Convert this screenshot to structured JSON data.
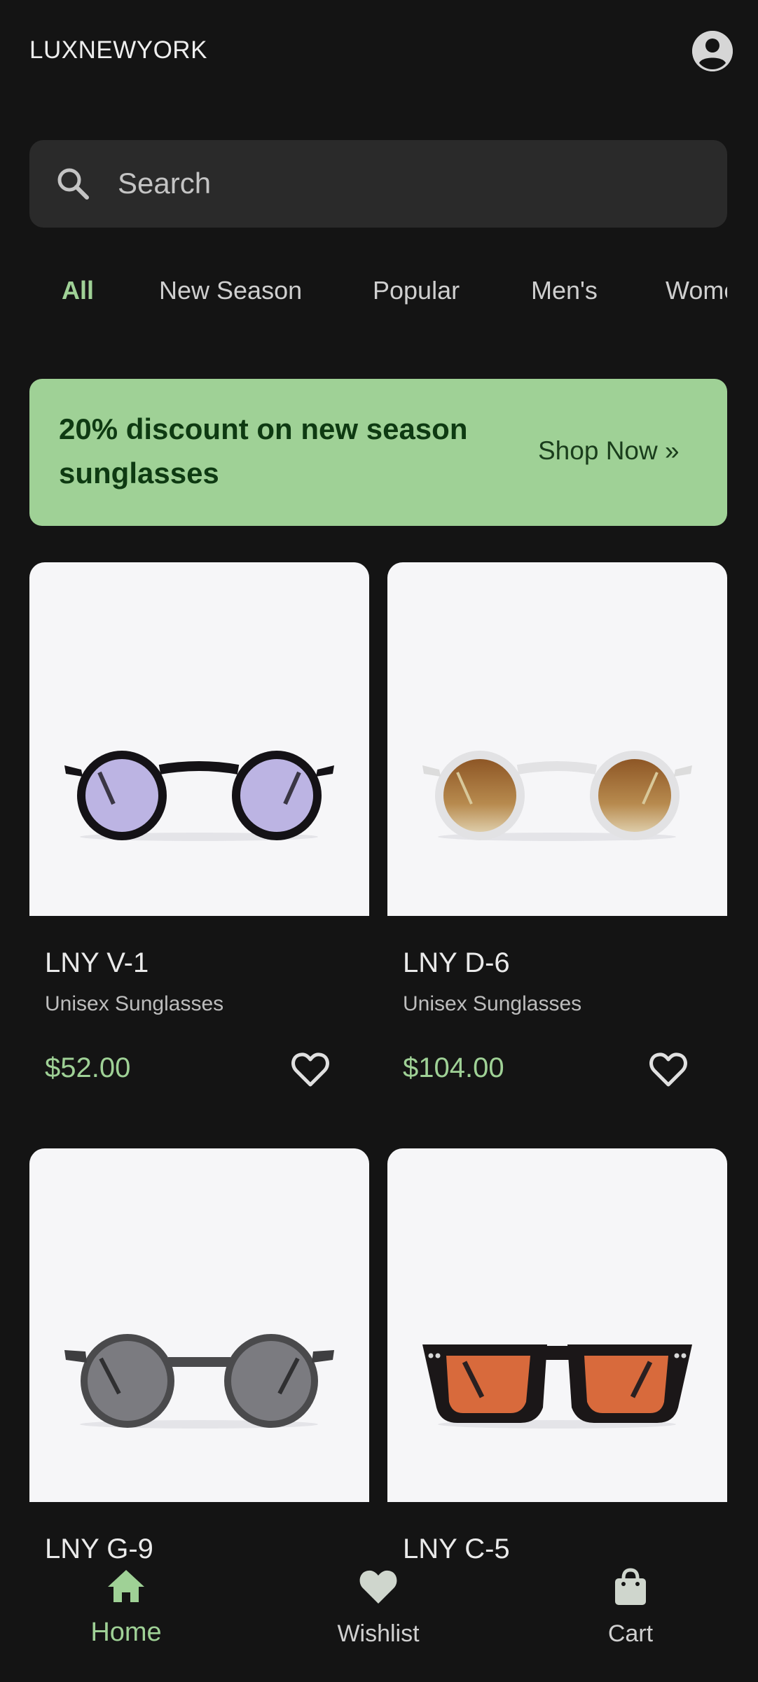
{
  "header": {
    "brand": "LUXNEWYORK",
    "profile_icon": "account-circle-icon"
  },
  "search": {
    "placeholder": "Search",
    "icon": "search-icon"
  },
  "tabs": [
    {
      "label": "All",
      "active": true
    },
    {
      "label": "New Season",
      "active": false
    },
    {
      "label": "Popular",
      "active": false
    },
    {
      "label": "Men's",
      "active": false
    },
    {
      "label": "Women's",
      "active": false
    }
  ],
  "promo": {
    "text": "20% discount on new season sunglasses",
    "button": "Shop Now »"
  },
  "products": [
    {
      "name": "LNY V-1",
      "subtitle": "Unisex Sunglasses",
      "price": "$52.00",
      "lens_color": "#bcb4e3",
      "frame_color": "#141216"
    },
    {
      "name": "LNY D-6",
      "subtitle": "Unisex Sunglasses",
      "price": "$104.00",
      "lens_color": "#a56f33",
      "frame_color": "#e8e8e8"
    },
    {
      "name": "LNY G-9",
      "subtitle": "",
      "price": "",
      "lens_color": "#7b7b80",
      "frame_color": "#4a4a4c"
    },
    {
      "name": "LNY C-5",
      "subtitle": "",
      "price": "",
      "lens_color": "#d86a3c",
      "frame_color": "#1b1718"
    }
  ],
  "nav": [
    {
      "label": "Home",
      "icon": "home-icon",
      "active": true
    },
    {
      "label": "Wishlist",
      "icon": "heart-icon",
      "active": false
    },
    {
      "label": "Cart",
      "icon": "shopping-bag-icon",
      "active": false
    }
  ],
  "colors": {
    "accent": "#9fd196",
    "background": "#141414",
    "surface": "#2a2a2a",
    "card": "#f6f6f8"
  }
}
